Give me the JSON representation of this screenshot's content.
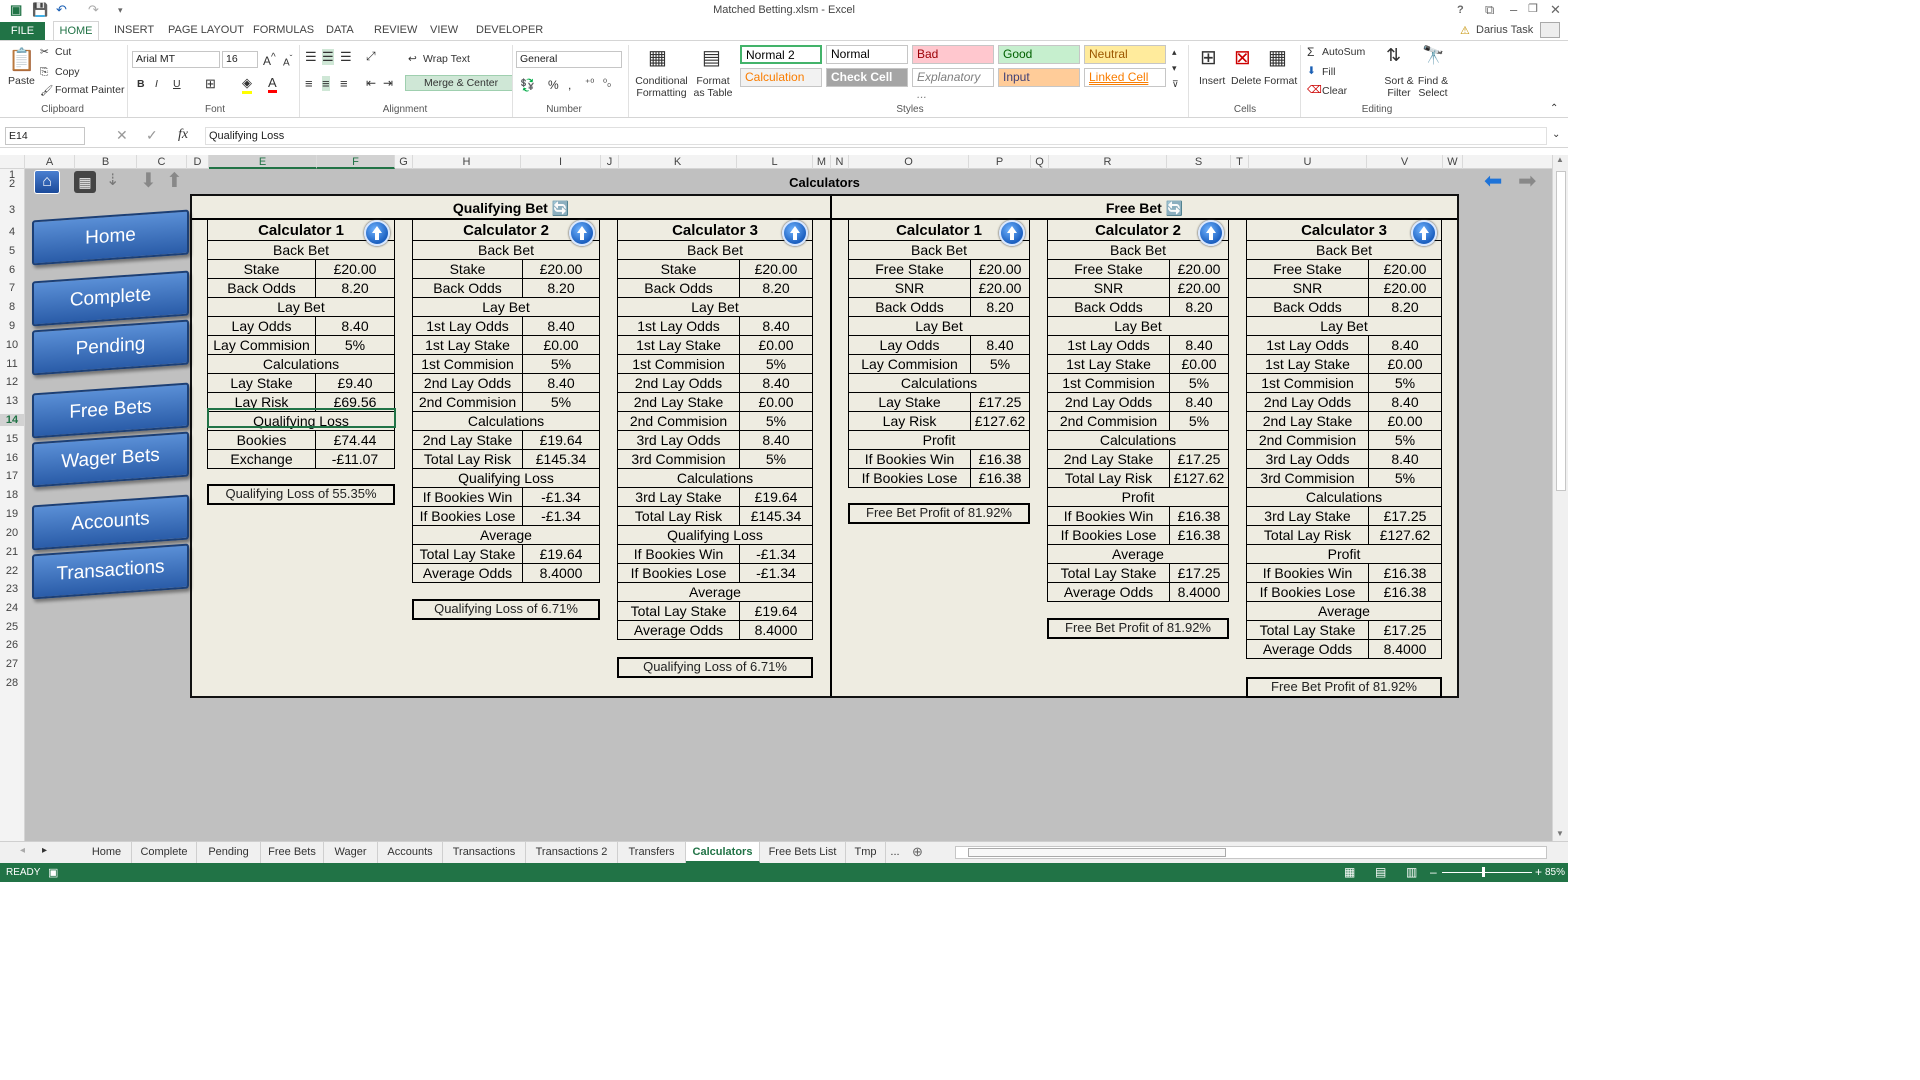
{
  "window": {
    "title": "Matched Betting.xlsm - Excel",
    "user": "Darius Task",
    "help": "?"
  },
  "ribbon_tabs": [
    "FILE",
    "HOME",
    "INSERT",
    "PAGE LAYOUT",
    "FORMULAS",
    "DATA",
    "REVIEW",
    "VIEW",
    "DEVELOPER"
  ],
  "ribbon": {
    "clipboard": {
      "paste": "Paste",
      "cut": "Cut",
      "copy": "Copy",
      "format_painter": "Format Painter",
      "label": "Clipboard"
    },
    "font": {
      "name": "Arial MT",
      "size": "16",
      "label": "Font"
    },
    "alignment": {
      "wrap": "Wrap Text",
      "merge": "Merge & Center",
      "label": "Alignment"
    },
    "number": {
      "format": "General",
      "label": "Number"
    },
    "styles": {
      "conditional": "Conditional Formatting",
      "format_table": "Format as Table",
      "cells": [
        {
          "name": "Normal 2",
          "bg": "#ffffff",
          "fg": "#000000"
        },
        {
          "name": "Normal",
          "bg": "#ffffff",
          "fg": "#000000"
        },
        {
          "name": "Bad",
          "bg": "#ffc7ce",
          "fg": "#9c0006"
        },
        {
          "name": "Good",
          "bg": "#c6efce",
          "fg": "#006100"
        },
        {
          "name": "Neutral",
          "bg": "#ffeb9c",
          "fg": "#9c5700"
        },
        {
          "name": "Calculation",
          "bg": "#f2f2f2",
          "fg": "#fa7d00"
        },
        {
          "name": "Check Cell",
          "bg": "#a5a5a5",
          "fg": "#ffffff"
        },
        {
          "name": "Explanatory ...",
          "bg": "#ffffff",
          "fg": "#7f7f7f"
        },
        {
          "name": "Input",
          "bg": "#ffcc99",
          "fg": "#3f3f76"
        },
        {
          "name": "Linked Cell",
          "bg": "#ffffff",
          "fg": "#fa7d00"
        }
      ],
      "label": "Styles"
    },
    "cells": {
      "insert": "Insert",
      "delete": "Delete",
      "format": "Format",
      "label": "Cells"
    },
    "editing": {
      "autosum": "AutoSum",
      "fill": "Fill",
      "clear": "Clear",
      "sort": "Sort & Filter",
      "find": "Find & Select",
      "label": "Editing"
    }
  },
  "formula_bar": {
    "name_box": "E14",
    "fx": "fx",
    "content": "Qualifying Loss"
  },
  "columns": [
    "A",
    "B",
    "C",
    "D",
    "E",
    "F",
    "G",
    "H",
    "I",
    "J",
    "K",
    "L",
    "M",
    "N",
    "O",
    "P",
    "Q",
    "R",
    "S",
    "T",
    "U",
    "V",
    "W"
  ],
  "rows": [
    "1",
    "2",
    "3",
    "4",
    "5",
    "6",
    "7",
    "8",
    "9",
    "10",
    "11",
    "12",
    "13",
    "14",
    "15",
    "16",
    "17",
    "18",
    "19",
    "20",
    "21",
    "22",
    "23",
    "24",
    "25",
    "26",
    "27",
    "28"
  ],
  "sheet": {
    "heading": "Calculators",
    "qualifying_heading": "Qualifying Bet",
    "free_heading": "Free Bet",
    "nav": [
      "Home",
      "Complete",
      "Pending",
      "Free Bets",
      "Wager Bets",
      "Accounts",
      "Transactions"
    ],
    "q1": {
      "title": "Calculator 1",
      "rows": [
        {
          "h": "Back Bet"
        },
        {
          "l": "Stake",
          "v": "£20.00"
        },
        {
          "l": "Back Odds",
          "v": "8.20"
        },
        {
          "h": "Lay Bet"
        },
        {
          "l": "Lay Odds",
          "v": "8.40"
        },
        {
          "l": "Lay Commision",
          "v": "5%"
        },
        {
          "h": "Calculations"
        },
        {
          "l": "Lay Stake",
          "v": "£9.40"
        },
        {
          "l": "Lay Risk",
          "v": "£69.56"
        },
        {
          "h": "Qualifying Loss"
        },
        {
          "l": "Bookies",
          "v": "£74.44"
        },
        {
          "l": "Exchange",
          "v": "-£11.07"
        }
      ],
      "result": "Qualifying Loss of 55.35%"
    },
    "q2": {
      "title": "Calculator 2",
      "rows": [
        {
          "h": "Back Bet"
        },
        {
          "l": "Stake",
          "v": "£20.00"
        },
        {
          "l": "Back Odds",
          "v": "8.20"
        },
        {
          "h": "Lay Bet"
        },
        {
          "l": "1st Lay Odds",
          "v": "8.40"
        },
        {
          "l": "1st Lay Stake",
          "v": "£0.00"
        },
        {
          "l": "1st Commision",
          "v": "5%"
        },
        {
          "l": "2nd Lay Odds",
          "v": "8.40"
        },
        {
          "l": "2nd Commision",
          "v": "5%"
        },
        {
          "h": "Calculations"
        },
        {
          "l": "2nd Lay Stake",
          "v": "£19.64"
        },
        {
          "l": "Total Lay Risk",
          "v": "£145.34"
        },
        {
          "h": "Qualifying Loss"
        },
        {
          "l": "If Bookies Win",
          "v": "-£1.34"
        },
        {
          "l": "If Bookies Lose",
          "v": "-£1.34"
        },
        {
          "h": "Average"
        },
        {
          "l": "Total Lay Stake",
          "v": "£19.64"
        },
        {
          "l": "Average Odds",
          "v": "8.4000"
        }
      ],
      "result": "Qualifying Loss of 6.71%"
    },
    "q3": {
      "title": "Calculator 3",
      "rows": [
        {
          "h": "Back Bet"
        },
        {
          "l": "Stake",
          "v": "£20.00"
        },
        {
          "l": "Back Odds",
          "v": "8.20"
        },
        {
          "h": "Lay Bet"
        },
        {
          "l": "1st Lay Odds",
          "v": "8.40"
        },
        {
          "l": "1st Lay Stake",
          "v": "£0.00"
        },
        {
          "l": "1st Commision",
          "v": "5%"
        },
        {
          "l": "2nd Lay Odds",
          "v": "8.40"
        },
        {
          "l": "2nd Lay Stake",
          "v": "£0.00"
        },
        {
          "l": "2nd Commision",
          "v": "5%"
        },
        {
          "l": "3rd Lay Odds",
          "v": "8.40"
        },
        {
          "l": "3rd Commision",
          "v": "5%"
        },
        {
          "h": "Calculations"
        },
        {
          "l": "3rd Lay Stake",
          "v": "£19.64"
        },
        {
          "l": "Total Lay Risk",
          "v": "£145.34"
        },
        {
          "h": "Qualifying Loss"
        },
        {
          "l": "If Bookies Win",
          "v": "-£1.34"
        },
        {
          "l": "If Bookies Lose",
          "v": "-£1.34"
        },
        {
          "h": "Average"
        },
        {
          "l": "Total Lay Stake",
          "v": "£19.64"
        },
        {
          "l": "Average Odds",
          "v": "8.4000"
        }
      ],
      "result": "Qualifying Loss of 6.71%"
    },
    "f1": {
      "title": "Calculator 1",
      "rows": [
        {
          "h": "Back Bet"
        },
        {
          "l": "Free Stake",
          "v": "£20.00"
        },
        {
          "l": "SNR",
          "v": "£20.00"
        },
        {
          "l": "Back Odds",
          "v": "8.20"
        },
        {
          "h": "Lay Bet"
        },
        {
          "l": "Lay Odds",
          "v": "8.40"
        },
        {
          "l": "Lay Commision",
          "v": "5%"
        },
        {
          "h": "Calculations"
        },
        {
          "l": "Lay Stake",
          "v": "£17.25"
        },
        {
          "l": "Lay Risk",
          "v": "£127.62"
        },
        {
          "h": "Profit"
        },
        {
          "l": "If Bookies Win",
          "v": "£16.38"
        },
        {
          "l": "If Bookies Lose",
          "v": "£16.38"
        }
      ],
      "result": "Free Bet Profit of 81.92%"
    },
    "f2": {
      "title": "Calculator 2",
      "rows": [
        {
          "h": "Back Bet"
        },
        {
          "l": "Free Stake",
          "v": "£20.00"
        },
        {
          "l": "SNR",
          "v": "£20.00"
        },
        {
          "l": "Back Odds",
          "v": "8.20"
        },
        {
          "h": "Lay Bet"
        },
        {
          "l": "1st Lay Odds",
          "v": "8.40"
        },
        {
          "l": "1st Lay Stake",
          "v": "£0.00"
        },
        {
          "l": "1st Commision",
          "v": "5%"
        },
        {
          "l": "2nd Lay Odds",
          "v": "8.40"
        },
        {
          "l": "2nd Commision",
          "v": "5%"
        },
        {
          "h": "Calculations"
        },
        {
          "l": "2nd Lay Stake",
          "v": "£17.25"
        },
        {
          "l": "Total Lay Risk",
          "v": "£127.62"
        },
        {
          "h": "Profit"
        },
        {
          "l": "If Bookies Win",
          "v": "£16.38"
        },
        {
          "l": "If Bookies Lose",
          "v": "£16.38"
        },
        {
          "h": "Average"
        },
        {
          "l": "Total Lay Stake",
          "v": "£17.25"
        },
        {
          "l": "Average Odds",
          "v": "8.4000"
        }
      ],
      "result": "Free Bet Profit of 81.92%"
    },
    "f3": {
      "title": "Calculator 3",
      "rows": [
        {
          "h": "Back Bet"
        },
        {
          "l": "Free Stake",
          "v": "£20.00"
        },
        {
          "l": "SNR",
          "v": "£20.00"
        },
        {
          "l": "Back Odds",
          "v": "8.20"
        },
        {
          "h": "Lay Bet"
        },
        {
          "l": "1st Lay Odds",
          "v": "8.40"
        },
        {
          "l": "1st Lay Stake",
          "v": "£0.00"
        },
        {
          "l": "1st Commision",
          "v": "5%"
        },
        {
          "l": "2nd Lay Odds",
          "v": "8.40"
        },
        {
          "l": "2nd Lay Stake",
          "v": "£0.00"
        },
        {
          "l": "2nd Commision",
          "v": "5%"
        },
        {
          "l": "3rd Lay Odds",
          "v": "8.40"
        },
        {
          "l": "3rd Commision",
          "v": "5%"
        },
        {
          "h": "Calculations"
        },
        {
          "l": "3rd Lay Stake",
          "v": "£17.25"
        },
        {
          "l": "Total Lay Risk",
          "v": "£127.62"
        },
        {
          "h": "Profit"
        },
        {
          "l": "If Bookies Win",
          "v": "£16.38"
        },
        {
          "l": "If Bookies Lose",
          "v": "£16.38"
        },
        {
          "h": "Average"
        },
        {
          "l": "Total Lay Stake",
          "v": "£17.25"
        },
        {
          "l": "Average Odds",
          "v": "8.4000"
        }
      ],
      "result": "Free Bet Profit of 81.92%"
    }
  },
  "sheet_tabs": [
    "Home",
    "Complete",
    "Pending",
    "Free Bets",
    "Wager",
    "Accounts",
    "Transactions",
    "Transactions 2",
    "Transfers",
    "Calculators",
    "Free Bets List",
    "Tmp",
    "..."
  ],
  "active_sheet": "Calculators",
  "status": {
    "mode": "READY",
    "zoom": "85%"
  },
  "colors": {
    "accent": "#217346",
    "panel": "#eeece1",
    "nav_button": "#2a5ca8"
  }
}
